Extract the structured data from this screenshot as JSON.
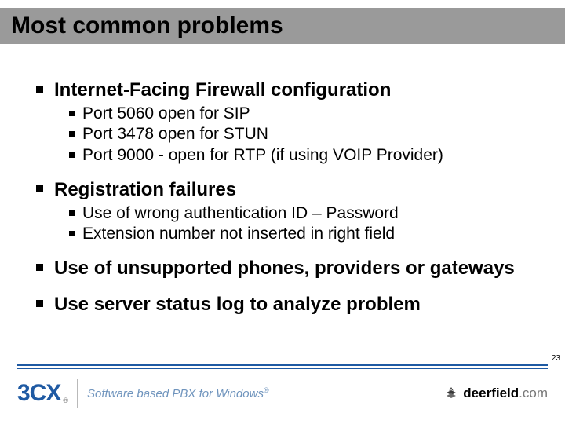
{
  "title": "Most common problems",
  "bullets": [
    {
      "text": "Internet-Facing Firewall configuration",
      "sub": [
        "Port 5060 open for SIP",
        "Port 3478 open for STUN",
        "Port 9000 - open for RTP (if using VOIP Provider)"
      ]
    },
    {
      "text": "Registration failures",
      "sub": [
        "Use of wrong authentication ID – Password",
        "Extension number not inserted in right field"
      ]
    },
    {
      "text": "Use of unsupported phones, providers or gateways",
      "sub": []
    },
    {
      "text": "Use server status log to analyze problem",
      "sub": []
    }
  ],
  "footer": {
    "brand": "3CX",
    "registered": "®",
    "tagline": "Software based PBX for Windows",
    "partner": "deerfield",
    "partner_suffix": ".com"
  },
  "page_number": "23"
}
